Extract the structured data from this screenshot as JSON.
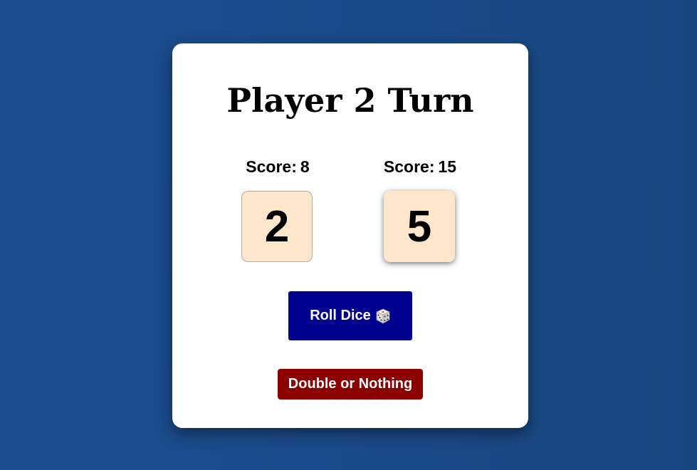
{
  "turn_title": "Player 2 Turn",
  "players": [
    {
      "score_label": "Score:",
      "score": "8",
      "die_value": "2",
      "active": false
    },
    {
      "score_label": "Score:",
      "score": "15",
      "die_value": "5",
      "active": true
    }
  ],
  "buttons": {
    "roll_label": "Roll Dice",
    "roll_icon": "dice-icon",
    "double_label": "Double or Nothing"
  },
  "colors": {
    "background": "#1c4d8f",
    "card": "#ffffff",
    "die_face": "#fde6cc",
    "roll_button": "#00008f",
    "double_button": "#8b0000"
  }
}
